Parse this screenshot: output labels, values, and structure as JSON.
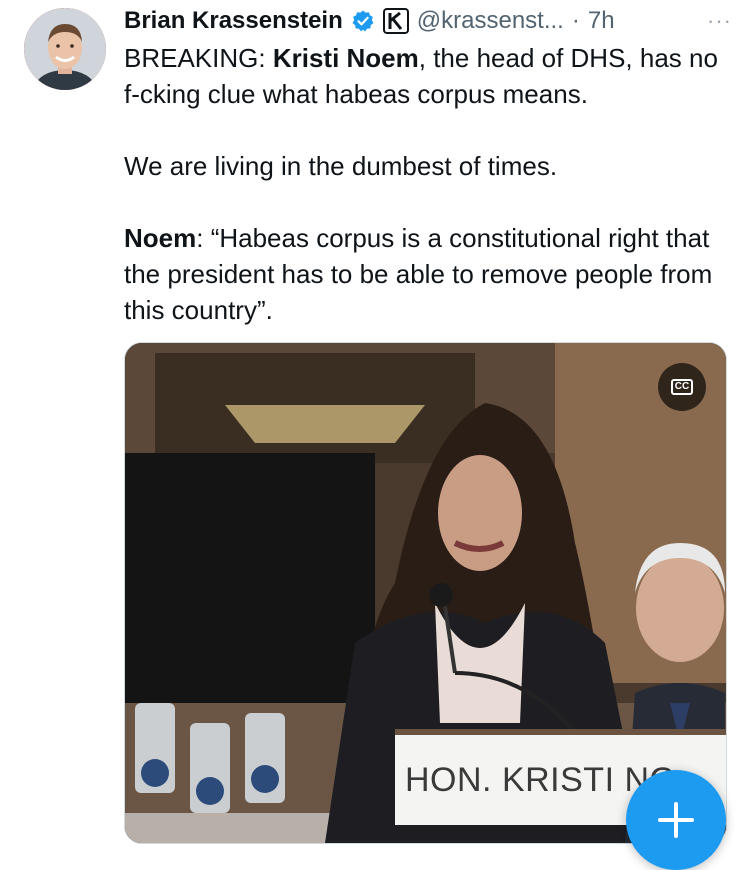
{
  "tweet": {
    "author_name": "Brian Krassenstein",
    "handle": "@krassenst...",
    "separator": "·",
    "time": "7h",
    "more_label": "···",
    "body": {
      "line1_prefix": "BREAKING: ",
      "line1_bold": "Kristi Noem",
      "line1_suffix": ", the head of DHS, has no f-cking clue what habeas corpus means.",
      "line2": "We are living in the dumbest of times.",
      "line3_bold": "Noem",
      "line3_rest": ": “Habeas corpus is a constitutional right that the president has to be able to remove people from this country”."
    },
    "media": {
      "cc_label": "CC",
      "placard_text": "HON. KRISTI NO"
    }
  },
  "icons": {
    "verified": "verified-badge-icon",
    "affiliate": "affiliate-logo-icon",
    "captions": "closed-captions-icon",
    "compose": "plus-icon"
  },
  "colors": {
    "accent": "#1d9bf0",
    "text": "#0f1419",
    "muted": "#536471"
  }
}
